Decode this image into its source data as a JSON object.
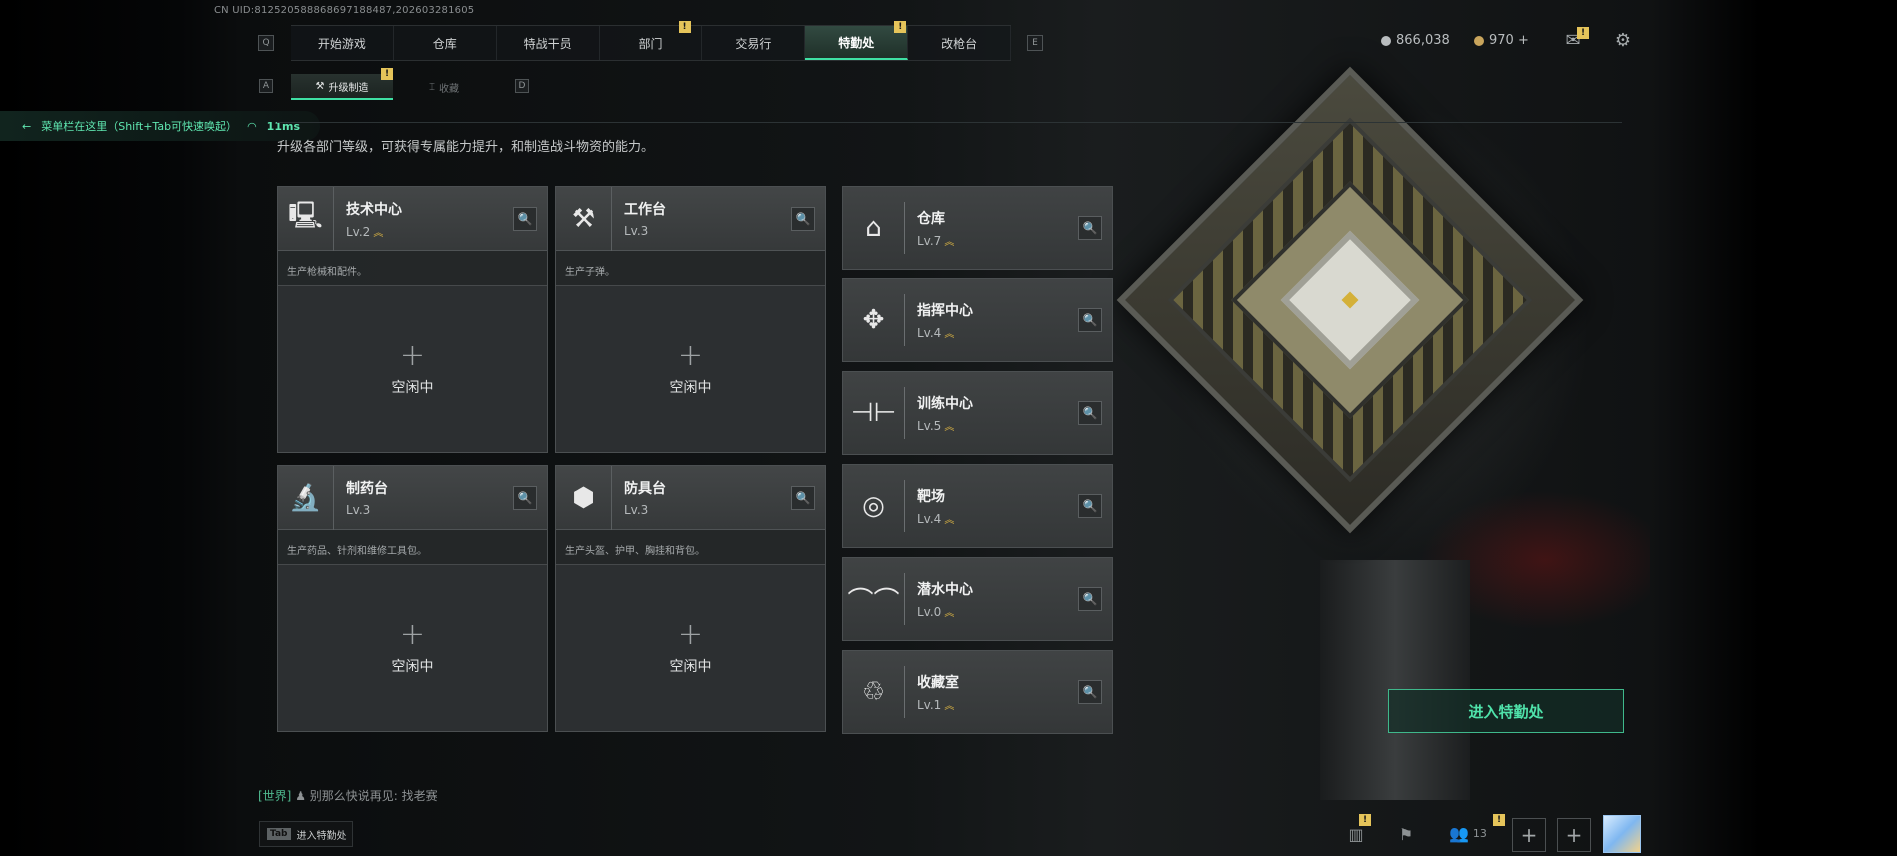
{
  "uid": "CN UID:812520588868697188487,202603281605",
  "nav": {
    "left_key": "Q",
    "right_key": "E",
    "tabs": [
      {
        "label": "开始游戏",
        "badge": ""
      },
      {
        "label": "仓库",
        "badge": ""
      },
      {
        "label": "特战干员",
        "badge": ""
      },
      {
        "label": "部门",
        "badge": "!"
      },
      {
        "label": "交易行",
        "badge": ""
      },
      {
        "label": "特勤处",
        "badge": "!",
        "active": true
      },
      {
        "label": "改枪台",
        "badge": ""
      }
    ]
  },
  "currency": {
    "coins": "866,038",
    "premium": "970 +",
    "coin_color": "#b9bdbf",
    "premium_color": "#c9a55c"
  },
  "top_icons": {
    "mail_badge": "!",
    "mail_icon": "mail-icon",
    "settings_icon": "gear-icon"
  },
  "subnav": {
    "left_key": "A",
    "right_key": "D",
    "tabs": [
      {
        "label": "升级制造",
        "badge": "!",
        "active": true
      },
      {
        "label": "收藏",
        "badge": ""
      }
    ]
  },
  "hint": {
    "text": "菜单栏在这里（Shift+Tab可快速唤起）",
    "ping": "11ms"
  },
  "description": "升级各部门等级，可获得专属能力提升，和制造战斗物资的能力。",
  "production": [
    {
      "name": "技术中心",
      "level": "Lv.2",
      "upgradeable": true,
      "icon": "computer-icon",
      "desc": "生产枪械和配件。",
      "slot_plus": "+",
      "slot": "空闲中"
    },
    {
      "name": "工作台",
      "level": "Lv.3",
      "upgradeable": false,
      "icon": "tools-icon",
      "desc": "生产子弹。",
      "slot_plus": "+",
      "slot": "空闲中"
    },
    {
      "name": "制药台",
      "level": "Lv.3",
      "upgradeable": false,
      "icon": "microscope-icon",
      "desc": "生产药品、针剂和维修工具包。",
      "slot_plus": "+",
      "slot": "空闲中"
    },
    {
      "name": "防具台",
      "level": "Lv.3",
      "upgradeable": false,
      "icon": "armor-icon",
      "desc": "生产头盔、护甲、胸挂和背包。",
      "slot_plus": "+",
      "slot": "空闲中"
    }
  ],
  "facilities": [
    {
      "name": "仓库",
      "level": "Lv.7",
      "icon": "warehouse-icon"
    },
    {
      "name": "指挥中心",
      "level": "Lv.4",
      "icon": "command-icon"
    },
    {
      "name": "训练中心",
      "level": "Lv.5",
      "icon": "dumbbell-icon"
    },
    {
      "name": "靶场",
      "level": "Lv.4",
      "icon": "target-icon"
    },
    {
      "name": "潜水中心",
      "level": "Lv.0",
      "icon": "diving-mask-icon"
    },
    {
      "name": "收藏室",
      "level": "Lv.1",
      "icon": "collection-icon"
    }
  ],
  "enter_button": "进入特勤处",
  "chat": {
    "channel": "[世界]",
    "message": "别那么快说再见: 找老赛"
  },
  "tab_hint": {
    "key": "Tab",
    "label": "进入特勤处"
  },
  "bottom_bar": {
    "friends_count": "13",
    "stats_badge": "!",
    "friends_badge": "!"
  },
  "accent_color": "#3fe0a4",
  "upgrade_color": "#d9b344"
}
